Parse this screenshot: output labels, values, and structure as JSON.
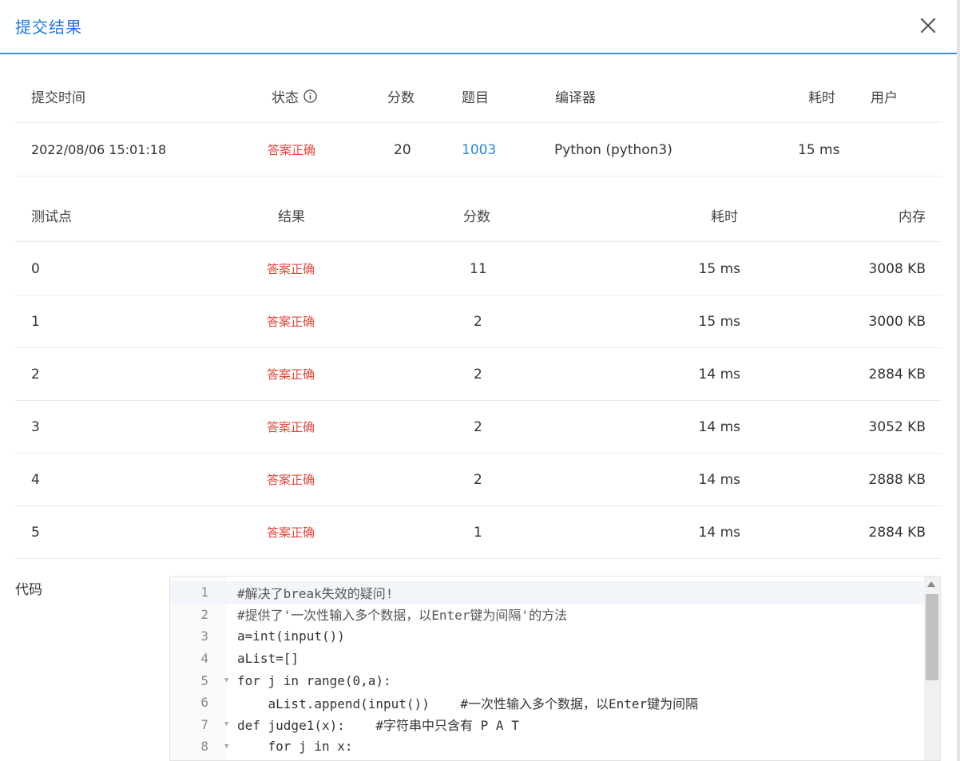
{
  "modal": {
    "title": "提交结果",
    "close_icon": "close-icon"
  },
  "summary": {
    "headers": {
      "time": "提交时间",
      "status": "状态",
      "score": "分数",
      "problem": "题目",
      "compiler": "编译器",
      "elapsed": "耗时",
      "user": "用户"
    },
    "row": {
      "time": "2022/08/06 15:01:18",
      "status": "答案正确",
      "score": "20",
      "problem": "1003",
      "compiler": "Python (python3)",
      "elapsed": "15 ms",
      "user": ""
    }
  },
  "cases": {
    "headers": {
      "id": "测试点",
      "result": "结果",
      "score": "分数",
      "elapsed": "耗时",
      "memory": "内存"
    },
    "rows": [
      {
        "id": "0",
        "result": "答案正确",
        "score": "11",
        "elapsed": "15 ms",
        "memory": "3008 KB"
      },
      {
        "id": "1",
        "result": "答案正确",
        "score": "2",
        "elapsed": "15 ms",
        "memory": "3000 KB"
      },
      {
        "id": "2",
        "result": "答案正确",
        "score": "2",
        "elapsed": "14 ms",
        "memory": "2884 KB"
      },
      {
        "id": "3",
        "result": "答案正确",
        "score": "2",
        "elapsed": "14 ms",
        "memory": "3052 KB"
      },
      {
        "id": "4",
        "result": "答案正确",
        "score": "2",
        "elapsed": "14 ms",
        "memory": "2888 KB"
      },
      {
        "id": "5",
        "result": "答案正确",
        "score": "1",
        "elapsed": "14 ms",
        "memory": "2884 KB"
      }
    ]
  },
  "code": {
    "label": "代码",
    "lines": [
      {
        "n": "1",
        "text": "#解决了break失效的疑问!"
      },
      {
        "n": "2",
        "text": "#提供了'一次性输入多个数据，以Enter键为间隔'的方法"
      },
      {
        "n": "3",
        "text": "a=int(input())"
      },
      {
        "n": "4",
        "text": "aList=[]"
      },
      {
        "n": "5",
        "text": "for j in range(0,a):"
      },
      {
        "n": "6",
        "text": "    aList.append(input())    #一次性输入多个数据，以Enter键为间隔"
      },
      {
        "n": "7",
        "text": "def judge1(x):    #字符串中只含有 P A T"
      },
      {
        "n": "8",
        "text": "    for j in x:"
      }
    ]
  },
  "colors": {
    "accent": "#1f7ae0",
    "link": "#2a86d8",
    "ok": "#e0463a"
  }
}
